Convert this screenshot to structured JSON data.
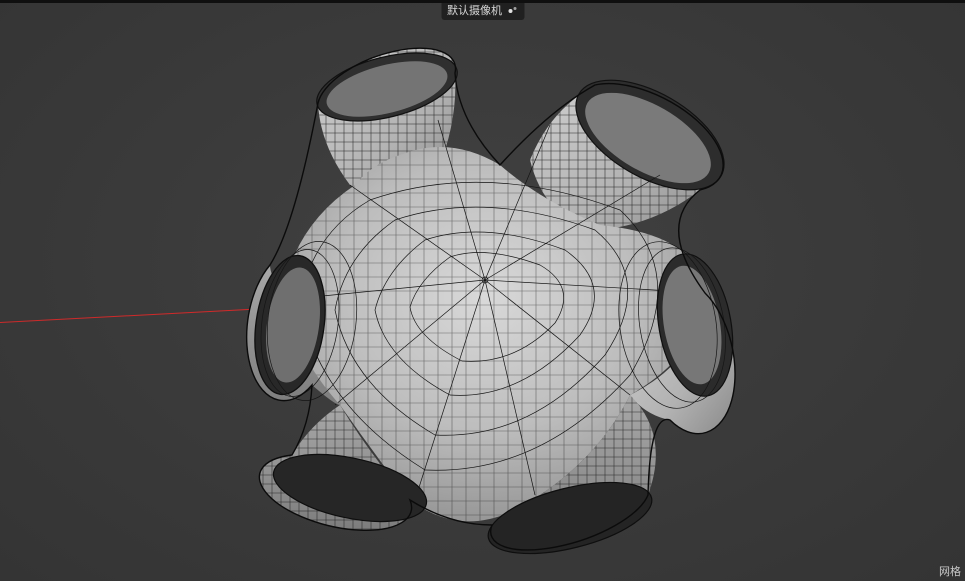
{
  "viewport": {
    "camera_label": "默认摄像机",
    "bottom_right_label": "网格",
    "axis_color": "#d02828",
    "background_color": "#3a3a3a",
    "wireframe_color": "#1a1a1a",
    "mesh_fill_light": "#d6d6d6",
    "mesh_fill_mid": "#b8b8b8",
    "mesh_fill_dark": "#8e8e8e"
  }
}
